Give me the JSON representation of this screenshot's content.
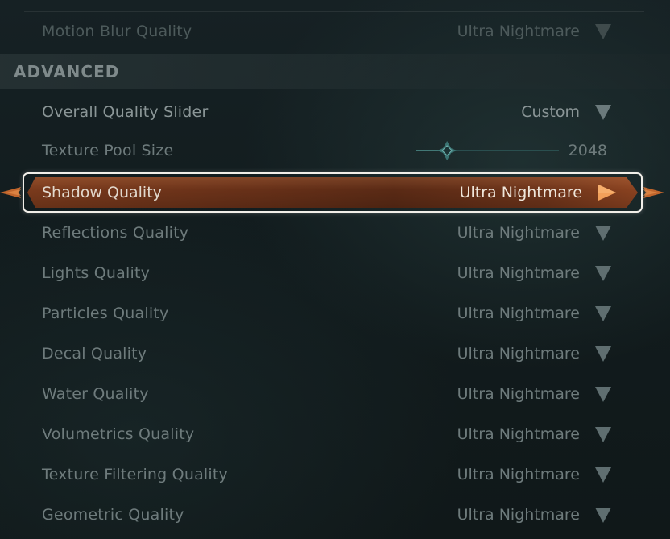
{
  "rows_above": [
    {
      "label": "Motion Blur Quality",
      "value": "Ultra Nightmare"
    }
  ],
  "section": {
    "title": "ADVANCED"
  },
  "overall_quality": {
    "label": "Overall Quality Slider",
    "value": "Custom"
  },
  "texture_pool": {
    "label": "Texture Pool Size",
    "value": "2048",
    "slider_fraction": 0.22
  },
  "selected": {
    "label": "Shadow Quality",
    "value": "Ultra Nightmare"
  },
  "settings": [
    {
      "label": "Reflections Quality",
      "value": "Ultra Nightmare"
    },
    {
      "label": "Lights Quality",
      "value": "Ultra Nightmare"
    },
    {
      "label": "Particles Quality",
      "value": "Ultra Nightmare"
    },
    {
      "label": "Decal Quality",
      "value": "Ultra Nightmare"
    },
    {
      "label": "Water Quality",
      "value": "Ultra Nightmare"
    },
    {
      "label": "Volumetrics Quality",
      "value": "Ultra Nightmare"
    },
    {
      "label": "Texture Filtering Quality",
      "value": "Ultra Nightmare"
    },
    {
      "label": "Geometric Quality",
      "value": "Ultra Nightmare"
    }
  ],
  "colors": {
    "accent": "#7a3a1c",
    "accent_arrow": "#f0a060",
    "text_muted": "#6e7b7c",
    "icon_muted": "#5f6e70"
  },
  "icons": {
    "dropdown": "triangle-down-icon",
    "selected_arrow": "triangle-right-icon",
    "slider_handle": "diamond-handle-icon"
  }
}
